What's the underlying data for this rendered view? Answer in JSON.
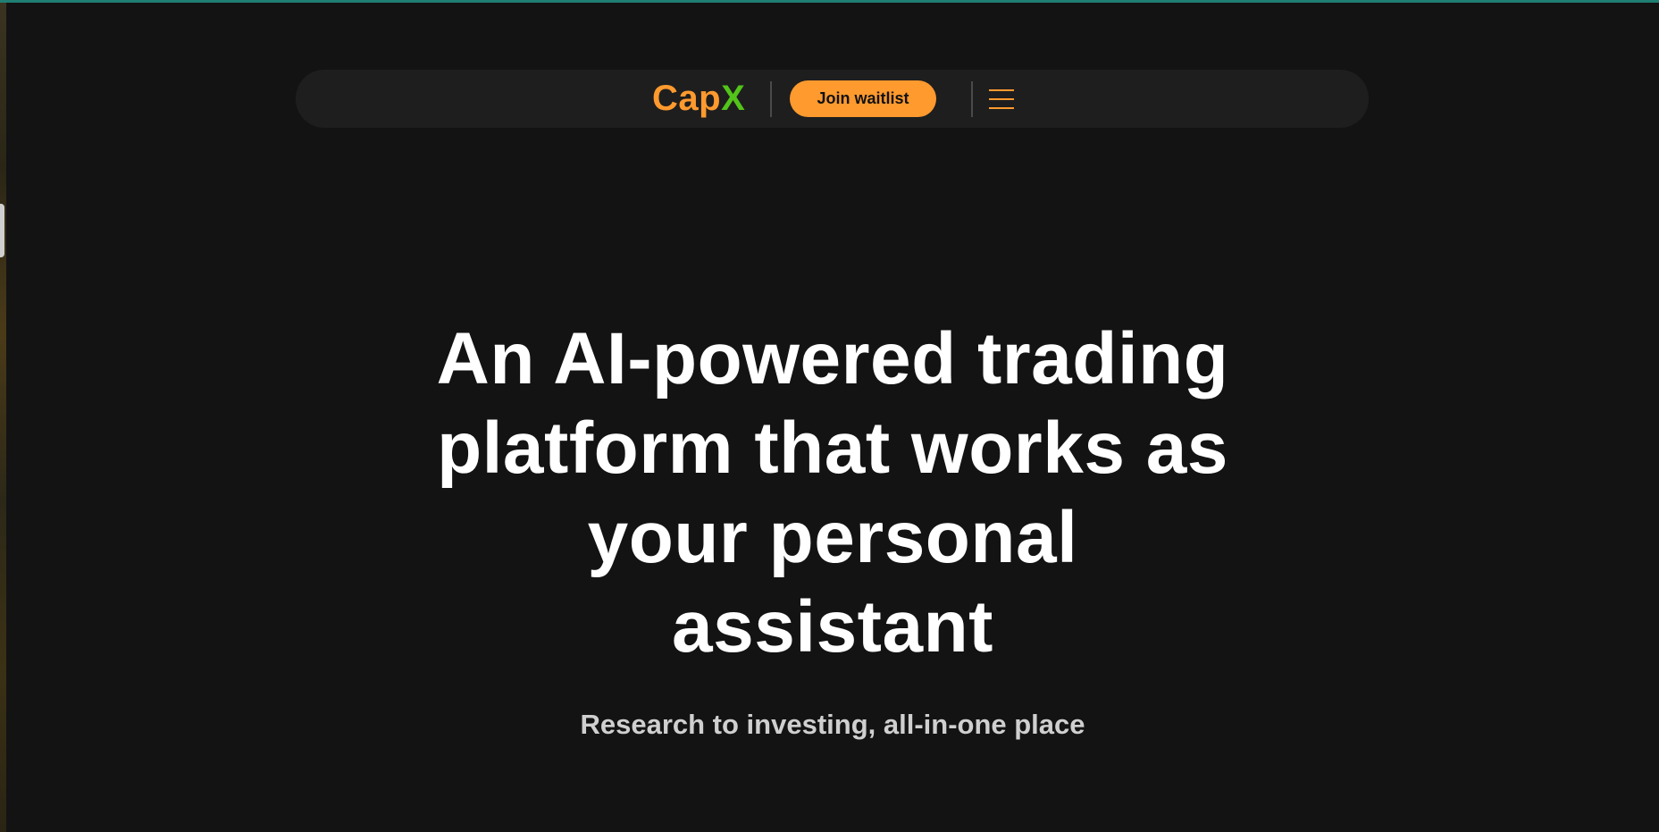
{
  "colors": {
    "background": "#131313",
    "navbar": "#1e1e1e",
    "accent_orange": "#ff9a2e",
    "accent_green": "#52c41a",
    "top_line": "#1f7f73",
    "text_primary": "#ffffff",
    "text_secondary": "#cfcfcf"
  },
  "header": {
    "brand_part1": "Cap",
    "brand_part2": "X",
    "waitlist_label": "Join waitlist",
    "menu_icon": "hamburger-menu-icon"
  },
  "hero": {
    "title_lines": [
      "An AI-powered trading",
      "platform that works as",
      "your personal",
      "assistant"
    ],
    "subtitle": "Research to investing, all-in-one place"
  }
}
